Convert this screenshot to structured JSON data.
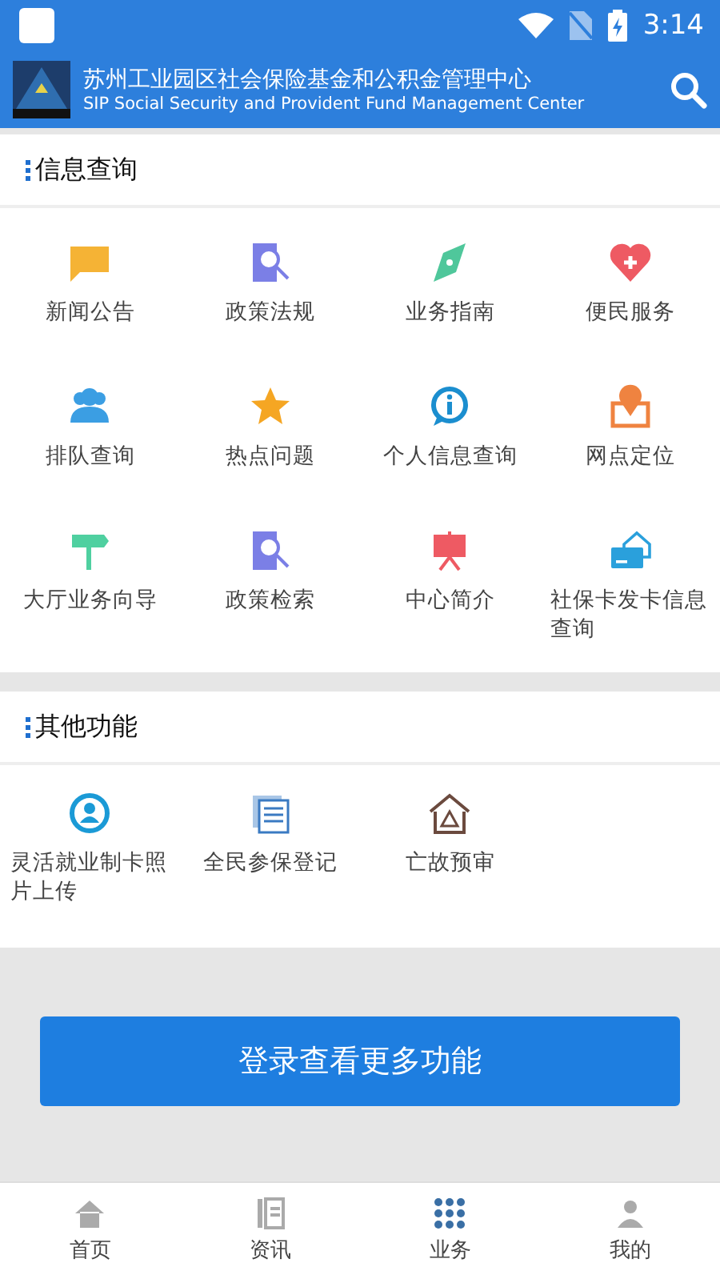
{
  "status_bar": {
    "time": "3:14"
  },
  "header": {
    "title": "苏州工业园区社会保险基金和公积金管理中心",
    "subtitle": "SIP Social Security and Provident Fund Management Center"
  },
  "sections": [
    {
      "title": "信息查询",
      "items": [
        {
          "label": "新闻公告"
        },
        {
          "label": "政策法规"
        },
        {
          "label": "业务指南"
        },
        {
          "label": "便民服务"
        },
        {
          "label": "排队查询"
        },
        {
          "label": "热点问题"
        },
        {
          "label": "个人信息查询"
        },
        {
          "label": "网点定位"
        },
        {
          "label": "大厅业务向导"
        },
        {
          "label": "政策检索"
        },
        {
          "label": "中心简介"
        },
        {
          "label": "社保卡发卡信息查询"
        }
      ]
    },
    {
      "title": "其他功能",
      "items": [
        {
          "label": "灵活就业制卡照片上传"
        },
        {
          "label": "全民参保登记"
        },
        {
          "label": "亡故预审"
        }
      ]
    }
  ],
  "login_button": "登录查看更多功能",
  "nav": [
    {
      "label": "首页",
      "selected": false
    },
    {
      "label": "资讯",
      "selected": false
    },
    {
      "label": "业务",
      "selected": true
    },
    {
      "label": "我的",
      "selected": false
    }
  ]
}
